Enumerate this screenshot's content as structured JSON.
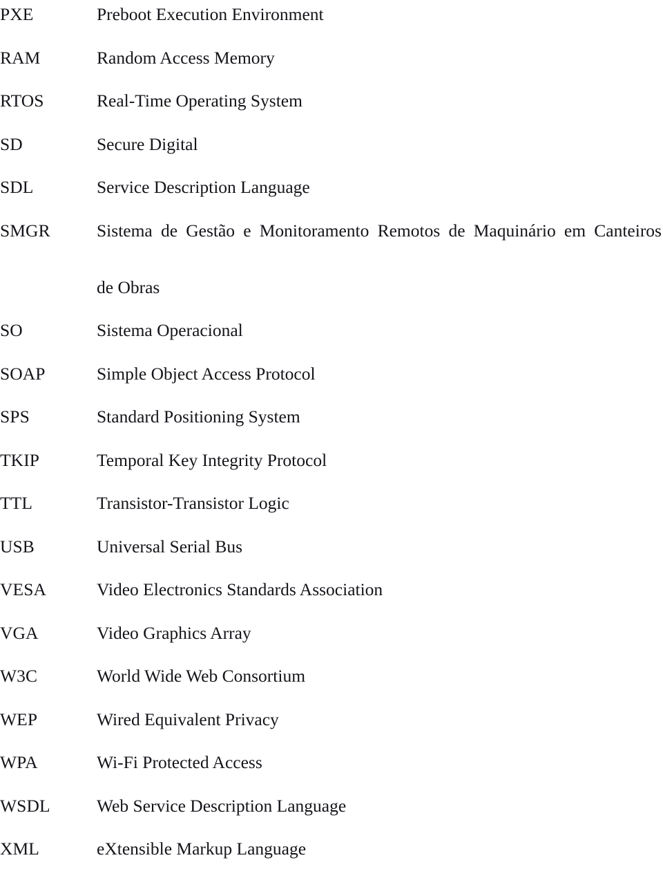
{
  "document": {
    "type": "list-of-acronyms",
    "page_background": "#ffffff",
    "text_color": "#14141a",
    "entries": [
      {
        "abbr": "PXE",
        "lines": [
          "Preboot Execution Environment"
        ]
      },
      {
        "abbr": "RAM",
        "lines": [
          "Random Access Memory"
        ]
      },
      {
        "abbr": "RTOS",
        "lines": [
          "Real-Time Operating System"
        ]
      },
      {
        "abbr": "SD",
        "lines": [
          "Secure Digital"
        ]
      },
      {
        "abbr": "SDL",
        "lines": [
          "Service Description Language"
        ]
      },
      {
        "abbr": "SMGR",
        "lines": [
          "Sistema de Gestão e Monitoramento Remotos de Maquinário em Canteiros",
          "de Obras"
        ]
      },
      {
        "abbr": "SO",
        "lines": [
          "Sistema Operacional"
        ]
      },
      {
        "abbr": "SOAP",
        "lines": [
          "Simple Object Access Protocol"
        ]
      },
      {
        "abbr": "SPS",
        "lines": [
          "Standard Positioning System"
        ]
      },
      {
        "abbr": "TKIP",
        "lines": [
          "Temporal Key Integrity Protocol"
        ]
      },
      {
        "abbr": "TTL",
        "lines": [
          "Transistor-Transistor Logic"
        ]
      },
      {
        "abbr": "USB",
        "lines": [
          "Universal Serial Bus"
        ]
      },
      {
        "abbr": "VESA",
        "lines": [
          "Video Electronics Standards Association"
        ]
      },
      {
        "abbr": "VGA",
        "lines": [
          "Video Graphics Array"
        ]
      },
      {
        "abbr": "W3C",
        "lines": [
          "World Wide Web Consortium"
        ]
      },
      {
        "abbr": "WEP",
        "lines": [
          "Wired Equivalent Privacy"
        ]
      },
      {
        "abbr": "WPA",
        "lines": [
          "Wi-Fi Protected Access"
        ]
      },
      {
        "abbr": "WSDL",
        "lines": [
          "Web Service Description Language"
        ]
      },
      {
        "abbr": "XML",
        "lines": [
          "eXtensible Markup Language"
        ]
      }
    ]
  }
}
